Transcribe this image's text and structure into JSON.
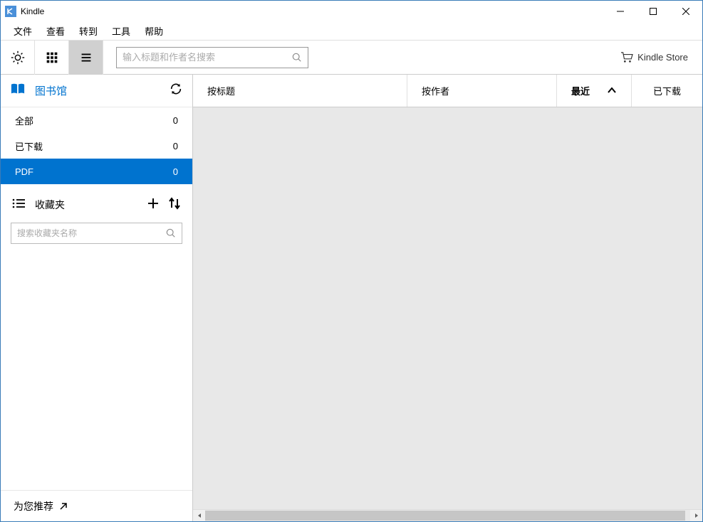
{
  "window": {
    "title": "Kindle"
  },
  "menubar": {
    "items": [
      "文件",
      "查看",
      "转到",
      "工具",
      "帮助"
    ]
  },
  "toolbar": {
    "search_placeholder": "输入标题和作者名搜索",
    "store_label": "Kindle Store"
  },
  "sidebar": {
    "library_title": "图书馆",
    "items": [
      {
        "label": "全部",
        "count": "0",
        "selected": false
      },
      {
        "label": "已下载",
        "count": "0",
        "selected": false
      },
      {
        "label": "PDF",
        "count": "0",
        "selected": true
      }
    ],
    "collections_title": "收藏夹",
    "collections_search_placeholder": "搜索收藏夹名称",
    "recommend_label": "为您推荐"
  },
  "sort": {
    "by_title": "按标题",
    "by_author": "按作者",
    "recent": "最近",
    "downloaded": "已下载"
  }
}
